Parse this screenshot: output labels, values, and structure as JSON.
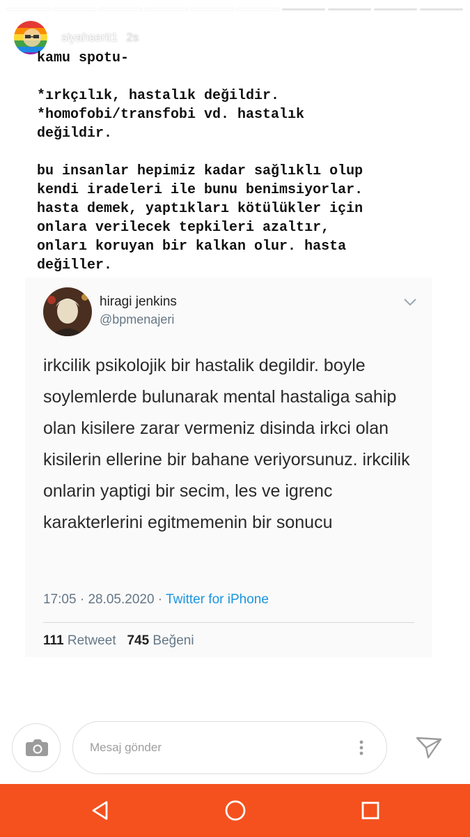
{
  "story": {
    "segments_total": 10,
    "segments_viewed": 6,
    "username": "siyahserit1",
    "time": "2s",
    "text": "kamu spotu-\n\n*ırkçılık, hastalık değildir.\n*homofobi/transfobi vd. hastalık\ndeğildir.\n\nbu insanlar hepimiz kadar sağlıklı olup\nkendi iradeleri ile bunu benimsiyorlar.\nhasta demek, yaptıkları kötülükler için\nonlara verilecek tepkileri azaltır,\nonları koruyan bir kalkan olur. hasta\ndeğiller."
  },
  "tweet": {
    "name": "hiragi jenkins",
    "handle": "@bpmenajeri",
    "body": "irkcilik psikolojik bir hastalik degildir. boyle soylemlerde bulunarak mental hastaliga sahip olan kisilere zarar vermeniz disinda irkci olan kisilerin ellerine bir bahane veriyorsunuz. irkcilik onlarin yaptigi bir secim, les ve igrenc karakterlerini egitmemenin bir sonucu",
    "time": "17:05",
    "separator": " · ",
    "date": "28.05.2020",
    "source": "Twitter for iPhone",
    "retweet_count": "111",
    "retweet_label": "Retweet",
    "like_count": "745",
    "like_label": "Beğeni"
  },
  "reply_bar": {
    "placeholder": "Mesaj gönder",
    "camera_icon": "camera-icon",
    "more_icon": "more-vertical-icon",
    "send_icon": "send-icon"
  },
  "navbar": {
    "color": "#f4511e",
    "back_icon": "back-triangle-icon",
    "home_icon": "home-circle-icon",
    "recents_icon": "recents-square-icon"
  }
}
